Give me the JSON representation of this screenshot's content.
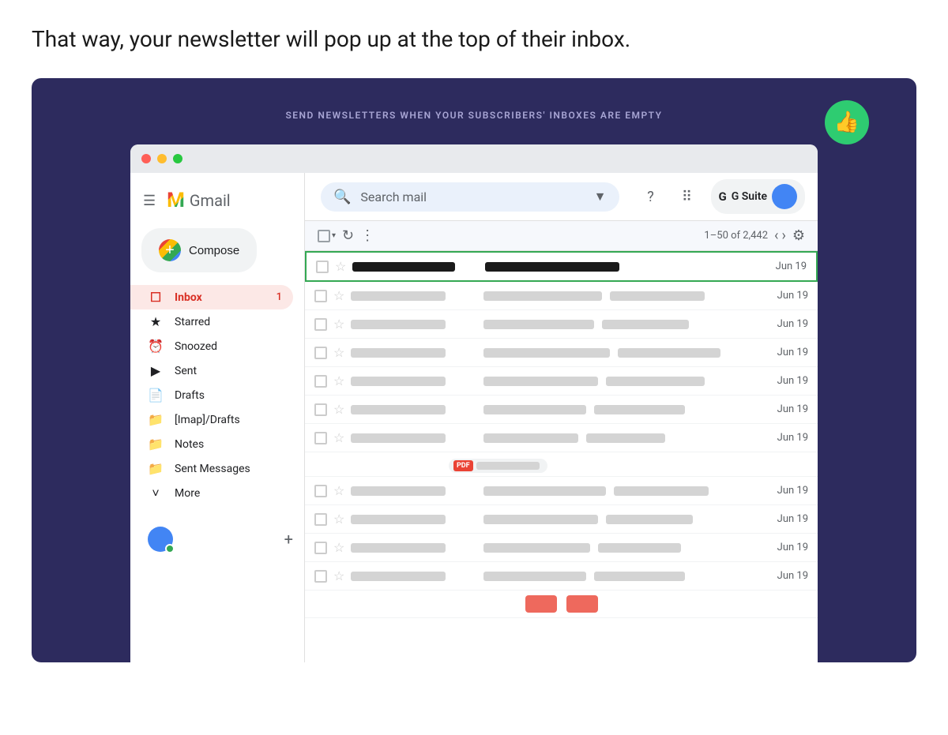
{
  "headline": "That way, your newsletter will pop up at the top of their inbox.",
  "subtitle": "SEND NEWSLETTERS WHEN YOUR SUBSCRIBERS' INBOXES ARE EMPTY",
  "thumbs_up": "👍",
  "gmail": {
    "wordmark": "Gmail",
    "search_placeholder": "Search mail",
    "compose_label": "Compose",
    "gsuite_label": "G Suite",
    "toolbar_count": "1–50 of 2,442"
  },
  "nav_items": [
    {
      "id": "inbox",
      "label": "Inbox",
      "icon": "☐",
      "badge": "1",
      "active": true
    },
    {
      "id": "starred",
      "label": "Starred",
      "icon": "★",
      "badge": "",
      "active": false
    },
    {
      "id": "snoozed",
      "label": "Snoozed",
      "icon": "🕐",
      "badge": "",
      "active": false
    },
    {
      "id": "sent",
      "label": "Sent",
      "icon": "▶",
      "badge": "",
      "active": false
    },
    {
      "id": "drafts",
      "label": "Drafts",
      "icon": "📄",
      "badge": "",
      "active": false
    },
    {
      "id": "imap-drafts",
      "label": "[Imap]/Drafts",
      "icon": "📁",
      "badge": "",
      "active": false
    },
    {
      "id": "notes",
      "label": "Notes",
      "icon": "📁",
      "badge": "",
      "active": false
    },
    {
      "id": "sent-messages",
      "label": "Sent Messages",
      "icon": "📁",
      "badge": "",
      "active": false
    },
    {
      "id": "more",
      "label": "More",
      "icon": "˅",
      "badge": "",
      "active": false
    }
  ],
  "emails": [
    {
      "date": "Jun 19",
      "highlighted": true
    },
    {
      "date": "Jun 19",
      "highlighted": false
    },
    {
      "date": "Jun 19",
      "highlighted": false
    },
    {
      "date": "Jun 19",
      "highlighted": false
    },
    {
      "date": "Jun 19",
      "highlighted": false
    },
    {
      "date": "Jun 19",
      "highlighted": false
    },
    {
      "date": "Jun 19",
      "highlighted": false
    },
    {
      "date": "Jun 19",
      "highlighted": false
    },
    {
      "date": "Jun 19",
      "highlighted": false
    },
    {
      "date": "Jun 19",
      "highlighted": false
    },
    {
      "date": "Jun 19",
      "highlighted": false
    }
  ],
  "colors": {
    "dark_bg": "#2d2b5e",
    "green_badge": "#2ecc71",
    "gmail_red": "#EA4335",
    "active_nav_bg": "#fce8e6"
  }
}
